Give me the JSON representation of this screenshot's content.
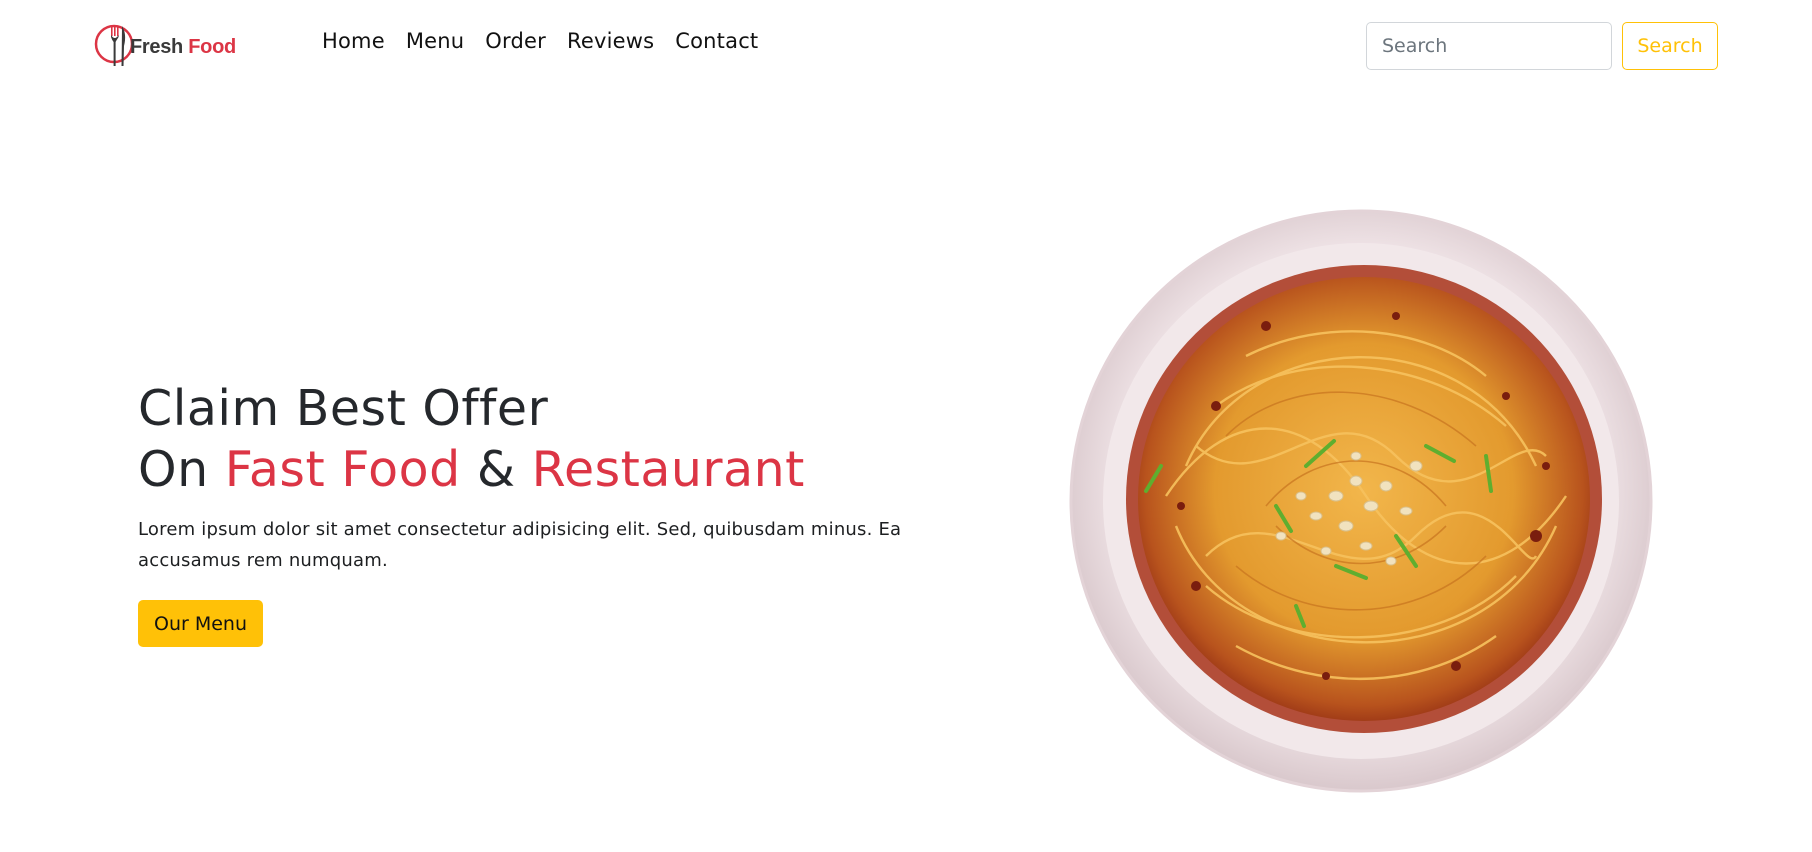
{
  "brand": {
    "word1": "Fresh",
    "word2": "Food"
  },
  "nav": {
    "links": [
      "Home",
      "Menu",
      "Order",
      "Reviews",
      "Contact"
    ]
  },
  "search": {
    "placeholder": "Search",
    "button_label": "Search"
  },
  "hero": {
    "title_line1": "Claim Best Offer",
    "title_on": "On",
    "title_fast_food": "Fast Food",
    "title_amp": "&",
    "title_restaurant": "Restaurant",
    "description": "Lorem ipsum dolor sit amet consectetur adipisicing elit. Sed, quibusdam minus. Ea accusamus rem numquam.",
    "cta_label": "Our Menu"
  },
  "colors": {
    "accent_red": "#dc3545",
    "accent_yellow": "#ffc107",
    "text_dark": "#25282c"
  }
}
